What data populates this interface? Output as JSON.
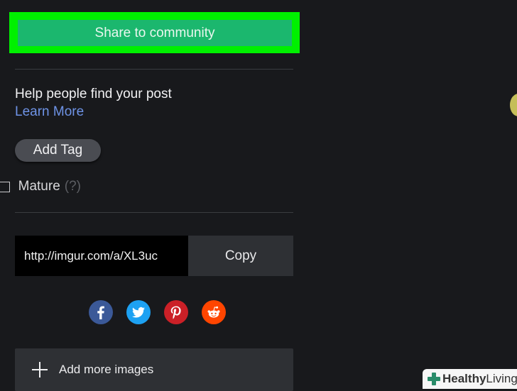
{
  "share": {
    "label": "Share to community",
    "highlight_color": "#00f000",
    "button_color": "#1bb76e"
  },
  "tags": {
    "help_text": "Help people find your post",
    "learn_more": "Learn More",
    "add_tag": "Add Tag"
  },
  "mature": {
    "label": "Mature",
    "help": "(?)",
    "checked": false
  },
  "link": {
    "url": "http://imgur.com/a/XL3uc",
    "copy_label": "Copy"
  },
  "social": [
    {
      "name": "facebook",
      "icon": "facebook-icon",
      "color": "#3b5998"
    },
    {
      "name": "twitter",
      "icon": "twitter-icon",
      "color": "#1da1f2"
    },
    {
      "name": "pinterest",
      "icon": "pinterest-icon",
      "color": "#cb2027"
    },
    {
      "name": "reddit",
      "icon": "reddit-icon",
      "color": "#ff4500"
    }
  ],
  "add_more": {
    "label": "Add more images",
    "icon": "plus-icon"
  },
  "watermark": {
    "brand_a": "Healthy",
    "brand_b": "Living"
  }
}
